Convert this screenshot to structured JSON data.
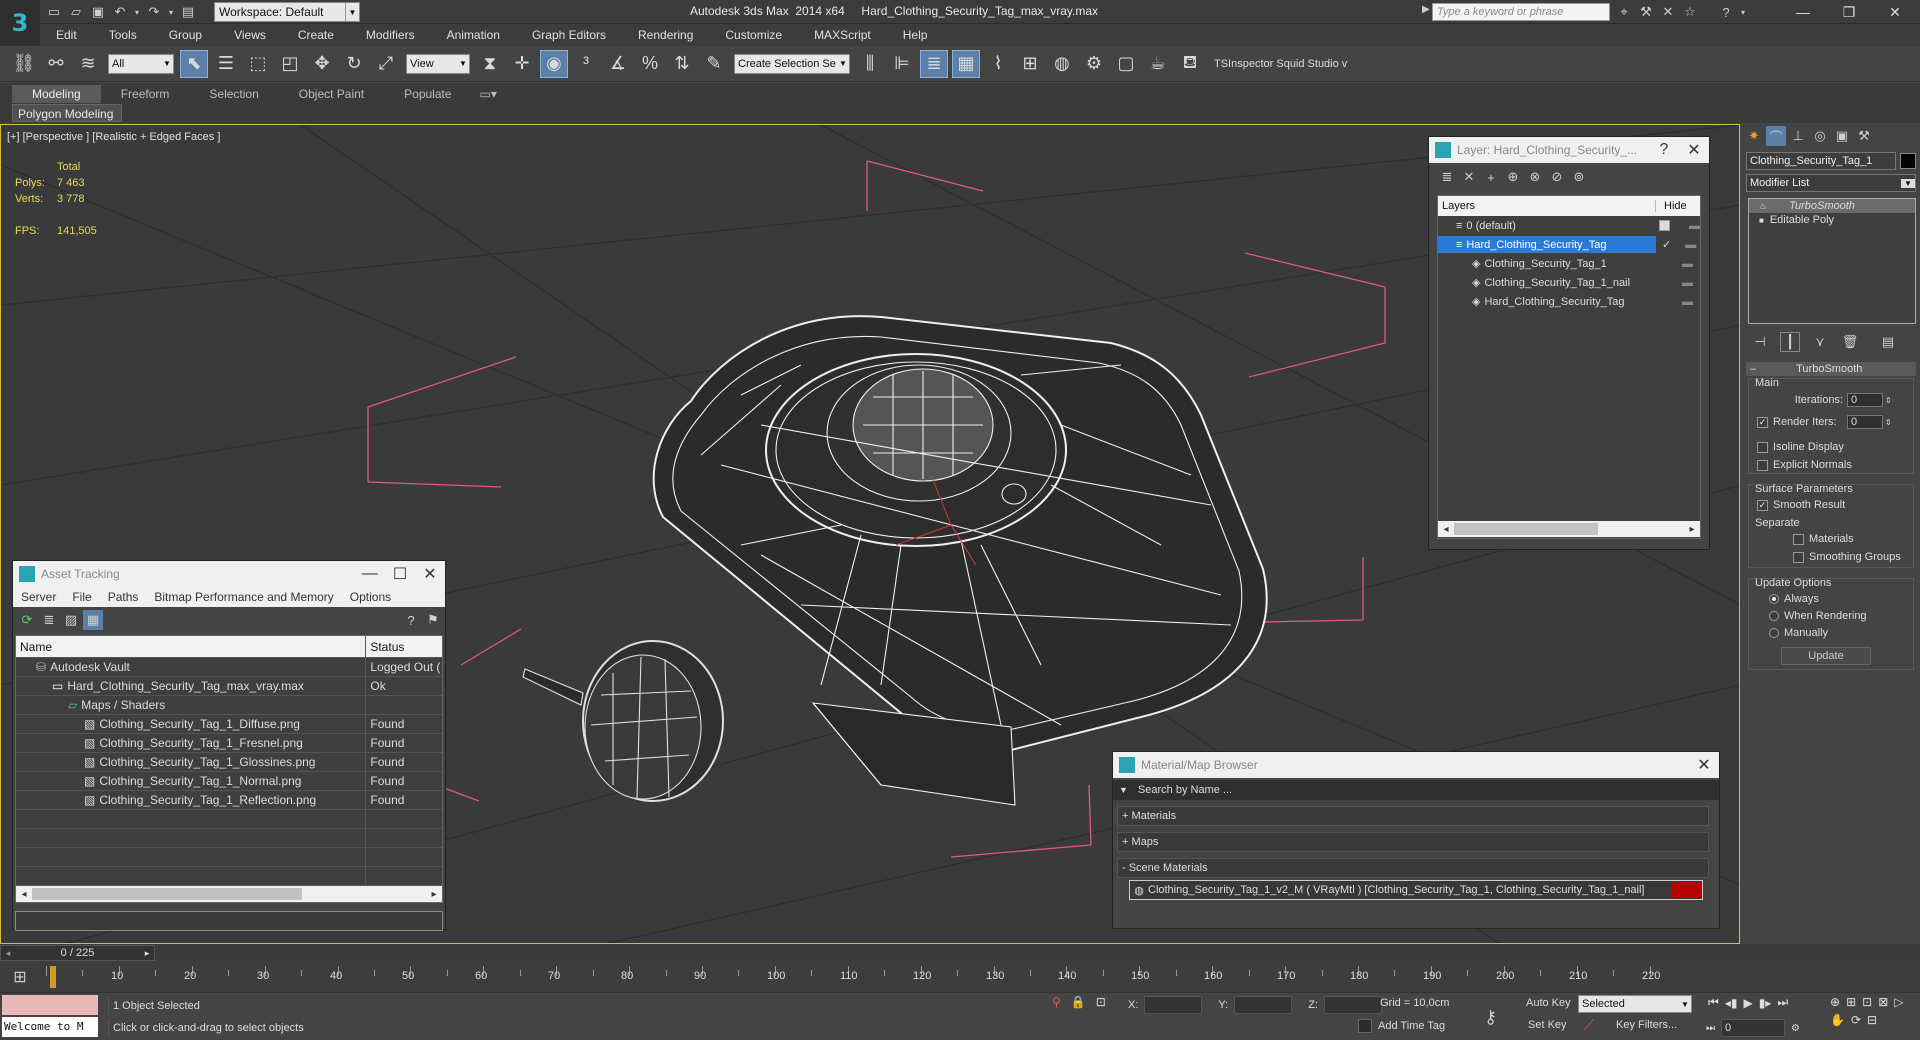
{
  "app": {
    "logo_letter": "3",
    "workspace": "Workspace: Default",
    "title": "Autodesk 3ds Max  2014 x64     Hard_Clothing_Security_Tag_max_vray.max",
    "search_placeholder": "Type a keyword or phrase"
  },
  "menu": [
    "Edit",
    "Tools",
    "Group",
    "Views",
    "Create",
    "Modifiers",
    "Animation",
    "Graph Editors",
    "Rendering",
    "Customize",
    "MAXScript",
    "Help"
  ],
  "toolbar": {
    "filter": "All",
    "ref_coord": "View",
    "selection_set": "Create Selection Se",
    "plugins": "TSInspector  Squid Studio v"
  },
  "ribbon": {
    "tabs": [
      "Modeling",
      "Freeform",
      "Selection",
      "Object Paint",
      "Populate"
    ],
    "sub": "Polygon Modeling"
  },
  "viewport": {
    "label": "[+] [Perspective ] [Realistic + Edged Faces ]",
    "total_label": "Total",
    "polys_label": "Polys:",
    "polys": "7 463",
    "verts_label": "Verts:",
    "verts": "3 778",
    "fps_label": "FPS:",
    "fps": "141,505"
  },
  "asset_tracking": {
    "title": "Asset Tracking",
    "menu": [
      "Server",
      "File",
      "Paths",
      "Bitmap Performance and Memory",
      "Options"
    ],
    "col_name": "Name",
    "col_status": "Status",
    "rows": [
      {
        "name": "Autodesk Vault",
        "status": "Logged Out (",
        "indent": 0
      },
      {
        "name": "Hard_Clothing_Security_Tag_max_vray.max",
        "status": "Ok",
        "indent": 1
      },
      {
        "name": "Maps / Shaders",
        "status": "",
        "indent": 2
      },
      {
        "name": "Clothing_Security_Tag_1_Diffuse.png",
        "status": "Found",
        "indent": 3
      },
      {
        "name": "Clothing_Security_Tag_1_Fresnel.png",
        "status": "Found",
        "indent": 3
      },
      {
        "name": "Clothing_Security_Tag_1_Glossines.png",
        "status": "Found",
        "indent": 3
      },
      {
        "name": "Clothing_Security_Tag_1_Normal.png",
        "status": "Found",
        "indent": 3
      },
      {
        "name": "Clothing_Security_Tag_1_Reflection.png",
        "status": "Found",
        "indent": 3
      }
    ]
  },
  "layer_explorer": {
    "title": "Layer: Hard_Clothing_Security_...",
    "col_layers": "Layers",
    "col_hide": "Hide",
    "rows": [
      {
        "name": "0 (default)",
        "indent": 0,
        "selected": false
      },
      {
        "name": "Hard_Clothing_Security_Tag",
        "indent": 0,
        "selected": true
      },
      {
        "name": "Clothing_Security_Tag_1",
        "indent": 1,
        "selected": false
      },
      {
        "name": "Clothing_Security_Tag_1_nail",
        "indent": 1,
        "selected": false
      },
      {
        "name": "Hard_Clothing_Security_Tag",
        "indent": 1,
        "selected": false
      }
    ]
  },
  "material_browser": {
    "title": "Material/Map Browser",
    "search": "Search by Name ...",
    "sections": [
      "+ Materials",
      "+ Maps",
      "- Scene Materials"
    ],
    "scene_material": "Clothing_Security_Tag_1_v2_M  ( VRayMtl ) [Clothing_Security_Tag_1, Clothing_Security_Tag_1_nail]"
  },
  "command_panel": {
    "object_name": "Clothing_Security_Tag_1",
    "modifier_list": "Modifier List",
    "stack": [
      "TurboSmooth",
      "Editable Poly"
    ],
    "rollout": "TurboSmooth",
    "main": "Main",
    "iterations_label": "Iterations:",
    "iterations": "0",
    "render_iters_label": "Render Iters:",
    "render_iters": "0",
    "isoline": "Isoline Display",
    "explicit_normals": "Explicit Normals",
    "surface_params": "Surface Parameters",
    "smooth_result": "Smooth Result",
    "separate": "Separate",
    "materials": "Materials",
    "smoothing_groups": "Smoothing Groups",
    "update_options": "Update Options",
    "always": "Always",
    "when_rendering": "When Rendering",
    "manually": "Manually",
    "update_btn": "Update"
  },
  "timeline": {
    "frame": "0 / 225",
    "ticks": [
      "10",
      "20",
      "30",
      "40",
      "50",
      "60",
      "70",
      "80",
      "90",
      "100",
      "110",
      "120",
      "130",
      "140",
      "150",
      "160",
      "170",
      "180",
      "190",
      "200",
      "210",
      "220"
    ]
  },
  "status": {
    "maxscript": "Welcome to M",
    "selected": "1 Object Selected",
    "prompt": "Click or click-and-drag to select objects",
    "x_label": "X:",
    "y_label": "Y:",
    "z_label": "Z:",
    "grid": "Grid = 10,0cm",
    "add_time_tag": "Add Time Tag",
    "auto_key": "Auto Key",
    "set_key": "Set Key",
    "key_mode": "Selected",
    "key_filters": "Key Filters...",
    "frame_field": "0"
  }
}
